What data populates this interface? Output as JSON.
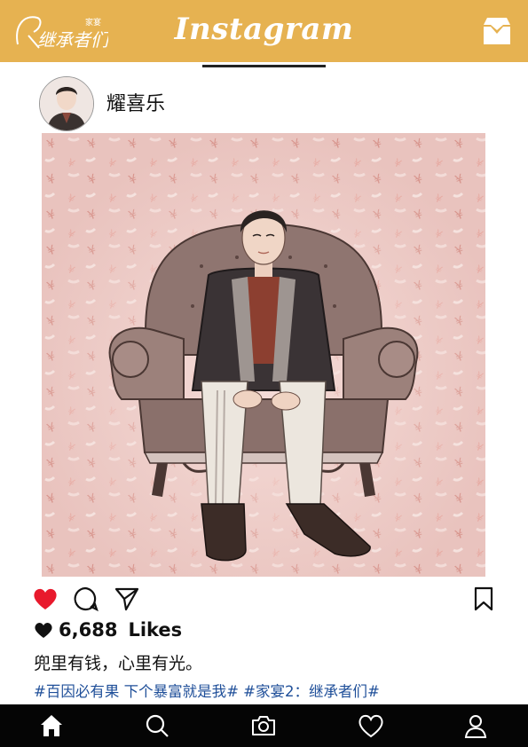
{
  "header": {
    "app_title": "Instagram",
    "brand_logo_text": "继承者们",
    "brand_logo_subtext": "家宴",
    "background_color": "#e6b251",
    "inbox_icon": "inbox-tray-icon"
  },
  "post": {
    "username": "耀喜乐",
    "image_description_icon": "illustrated-portrait-armchair",
    "actions": {
      "like_icon": "heart-filled-icon",
      "comment_icon": "comment-bubble-icon",
      "share_icon": "paper-plane-icon",
      "save_icon": "bookmark-icon",
      "like_color": "#e8192c"
    },
    "likes_count": "6,688",
    "likes_label": "Likes",
    "caption": "兜里有钱，心里有光。",
    "hashtags": "#百因必有果 下个暴富就是我# #家宴2：继承者们#",
    "hashtag_color": "#1f4f99"
  },
  "bottom_nav": {
    "items": [
      "home-icon",
      "search-icon",
      "camera-icon",
      "heart-outline-icon",
      "profile-icon"
    ],
    "background_color": "#050505"
  }
}
